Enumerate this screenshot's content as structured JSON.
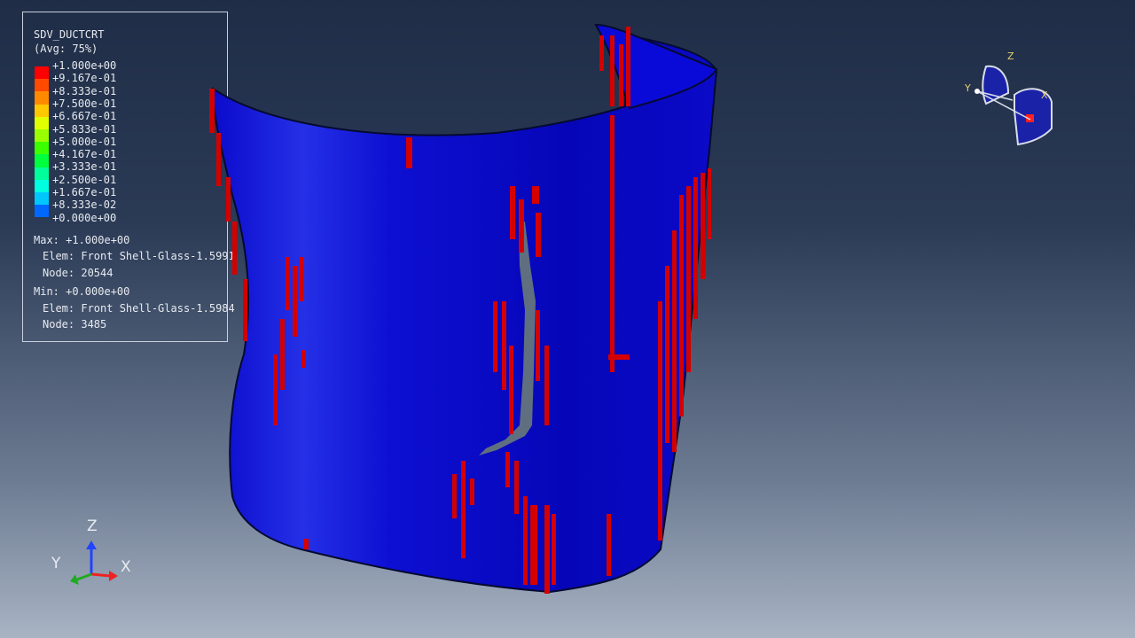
{
  "legend": {
    "variable": "SDV_DUCTCRT",
    "averaging": "(Avg: 75%)",
    "levels": [
      {
        "label": "+1.000e+00",
        "color": "#ff0000"
      },
      {
        "label": "+9.167e-01",
        "color": "#ff4a00"
      },
      {
        "label": "+8.333e-01",
        "color": "#ff8a00"
      },
      {
        "label": "+7.500e-01",
        "color": "#ffc800"
      },
      {
        "label": "+6.667e-01",
        "color": "#e0ff00"
      },
      {
        "label": "+5.833e-01",
        "color": "#9aff00"
      },
      {
        "label": "+5.000e-01",
        "color": "#3cff00"
      },
      {
        "label": "+4.167e-01",
        "color": "#00ff3c"
      },
      {
        "label": "+3.333e-01",
        "color": "#00ff9a"
      },
      {
        "label": "+2.500e-01",
        "color": "#00ffe0"
      },
      {
        "label": "+1.667e-01",
        "color": "#00c8ff"
      },
      {
        "label": "+8.333e-02",
        "color": "#0068ff"
      },
      {
        "label": "+0.000e+00",
        "color": "#0000ff"
      }
    ],
    "max": {
      "value": "Max: +1.000e+00",
      "elem": "Elem: Front Shell-Glass-1.5991",
      "node": "Node: 20544"
    },
    "min": {
      "value": "Min: +0.000e+00",
      "elem": "Elem: Front Shell-Glass-1.5984",
      "node": "Node: 3485"
    }
  },
  "triad": {
    "z": "Z",
    "y": "Y",
    "x": "X"
  },
  "viewcube": {
    "z": "Z",
    "y": "Y",
    "x": "X"
  },
  "colors": {
    "shell": "#0a0ad0",
    "shell_light": "#2a34e8",
    "crack": "#d40000",
    "eroded": "#5f6f80"
  }
}
